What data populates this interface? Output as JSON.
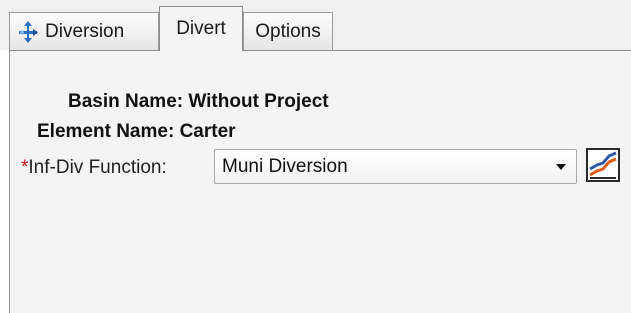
{
  "tabs": [
    {
      "label": "Diversion",
      "icon": "diversion-icon"
    },
    {
      "label": "Divert",
      "icon": null,
      "active": true
    },
    {
      "label": "Options",
      "icon": null
    }
  ],
  "form": {
    "basin_label": "Basin Name:",
    "basin_value": "Without Project",
    "element_label": "Element Name:",
    "element_value": "Carter",
    "required_marker": "*",
    "function_label": "Inf-Div Function:",
    "function_value": "Muni Diversion",
    "graph_button_icon": "paired-data-graph-icon"
  },
  "colors": {
    "required": "#d01818",
    "panel_bg": "#f4f4f4"
  }
}
